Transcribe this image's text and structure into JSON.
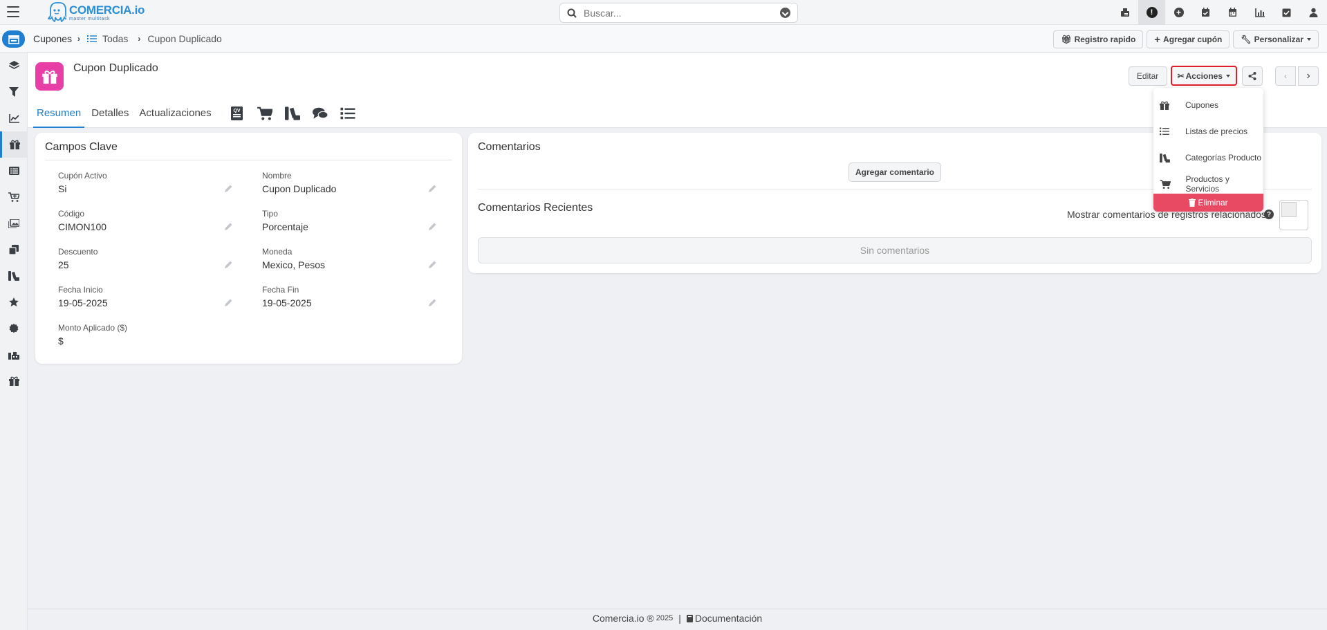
{
  "app": {
    "logo_title": "COMERCIA.io",
    "logo_subtitle": "master multitask"
  },
  "search": {
    "placeholder": "Buscar..."
  },
  "top_icons": [
    "fax-icon",
    "alert-icon",
    "plus-circle-icon",
    "calendar-check-icon",
    "calendar-icon",
    "chart-icon",
    "checkbox-icon",
    "user-icon"
  ],
  "breadcrumb": {
    "module": "Cupones",
    "list": "Todas",
    "record": "Cupon Duplicado"
  },
  "crumb_buttons": {
    "quick_create": "Registro rapido",
    "add_coupon": "Agregar cupón",
    "customize": "Personalizar"
  },
  "record": {
    "title": "Cupon Duplicado",
    "icon": "gift-icon",
    "icon_color": "#e83fa6"
  },
  "tabs": [
    {
      "label": "Resumen",
      "active": true
    },
    {
      "label": "Detalles",
      "active": false
    },
    {
      "label": "Actualizaciones",
      "active": false
    }
  ],
  "header_buttons": {
    "edit": "Editar",
    "actions": "Acciones"
  },
  "actions_menu": {
    "items": [
      {
        "label": "Cupones",
        "icon": "gift-icon"
      },
      {
        "label": "Listas de precios",
        "icon": "list-icon"
      },
      {
        "label": "Categorías Producto",
        "icon": "categories-icon"
      },
      {
        "label": "Productos y Servicios",
        "icon": "cart-icon"
      }
    ],
    "delete_label": "Eliminar"
  },
  "key_fields": {
    "title": "Campos Clave",
    "fields": [
      {
        "label": "Cupón Activo",
        "value": "Si"
      },
      {
        "label": "Nombre",
        "value": "Cupon Duplicado"
      },
      {
        "label": "Código",
        "value": "CIMON100"
      },
      {
        "label": "Tipo",
        "value": "Porcentaje"
      },
      {
        "label": "Descuento",
        "value": "25"
      },
      {
        "label": "Moneda",
        "value": "Mexico, Pesos"
      },
      {
        "label": "Fecha Inicio",
        "value": "19-05-2025"
      },
      {
        "label": "Fecha Fin",
        "value": "19-05-2025"
      },
      {
        "label": "Monto Aplicado ($)",
        "value": "$"
      }
    ]
  },
  "comments": {
    "title": "Comentarios",
    "add_button": "Agregar comentario",
    "recent_title": "Comentarios Recientes",
    "show_related": "Mostrar comentarios de registros relacionados",
    "empty": "Sin comentarios"
  },
  "footer": {
    "brand": "Comercia.io ®",
    "year": "2025",
    "docs": "Documentación"
  },
  "colors": {
    "primary": "#1f7fd0",
    "danger": "#e84a64",
    "highlight": "#e01d2a"
  }
}
